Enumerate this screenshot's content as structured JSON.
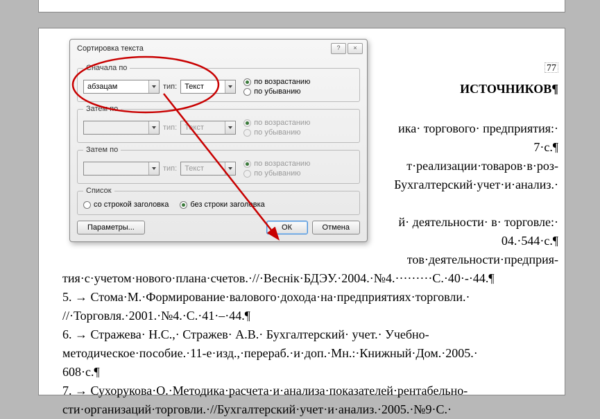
{
  "page_number": "77",
  "dialog": {
    "title": "Сортировка текста",
    "sort1": {
      "legend": "Сначала по",
      "field": "абзацам",
      "type_label": "тип:",
      "type_value": "Текст",
      "radio_asc": "по возрастанию",
      "radio_desc": "по убыванию"
    },
    "sort2": {
      "legend": "Затем по",
      "field": "",
      "type_label": "тип:",
      "type_value": "Текст",
      "radio_asc": "по возрастанию",
      "radio_desc": "по убыванию"
    },
    "sort3": {
      "legend": "Затем по",
      "field": "",
      "type_label": "тип:",
      "type_value": "Текст",
      "radio_asc": "по возрастанию",
      "radio_desc": "по убыванию"
    },
    "list": {
      "legend": "Список",
      "with_header": "со строкой заголовка",
      "no_header": "без строки заголовка"
    },
    "params": "Параметры...",
    "ok": "ОК",
    "cancel": "Отмена"
  },
  "document": {
    "heading": "ИСТОЧНИКОВ¶",
    "lines": [
      "ика· торгового· предприятия:·",
      "7·с.¶",
      "т·реализации·товаров·в·роз-",
      "Бухгалтерский·учет·и·анализ.·",
      "",
      "й· деятельности· в· торговле:·",
      "04.·544·с.¶",
      "тов·деятельности·предприя-",
      "тия·с·учетом·нового·плана·счетов.·//·Веснiк·БДЭУ.·2004.·№4.·········С.·40·-·44.¶",
      "5.   →   Стома·М.·Формирование·валового·дохода·на·предприятиях·торговли.·",
      "//·Торговля.·2001.·№4.·С.·41·–·44.¶",
      "6.   →   Стражева· Н.С.,· Стражев· А.В.· Бухгалтерский· учет.· Учебно-",
      "методическое·пособие.·11-е·изд.,·перераб.·и·доп.·Мн.:·Книжный·Дом.·2005.·",
      "608·с.¶",
      "7.   →   Сухорукова·О.·Методика·расчета·и·анализа·показателей·рентабельно-",
      "сти·организаций·торговли.·//Бухгалтерский·учет·и·анализ.·2005.·№9·С.·"
    ]
  }
}
